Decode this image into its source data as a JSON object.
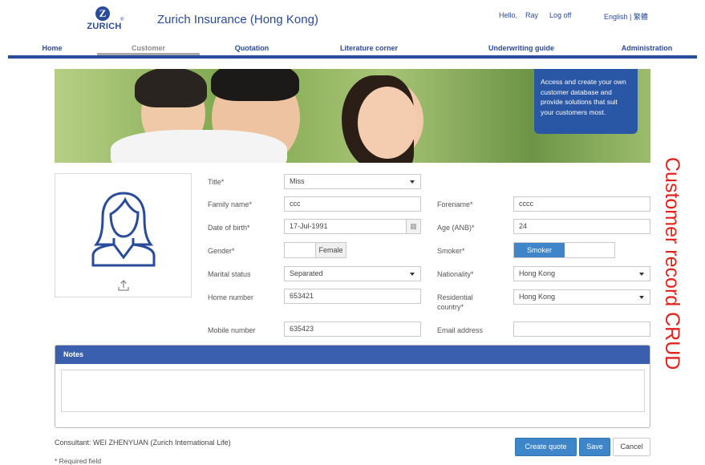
{
  "header": {
    "logo_mark": "Z",
    "logo_text": "ZURICH",
    "logo_reg": "®",
    "app_title": "Zurich Insurance (Hong Kong)",
    "greeting": "Hello,",
    "user_name": "Ray",
    "logoff": "Log off",
    "language": "English | 繁體"
  },
  "nav": {
    "items": [
      {
        "label": "Home"
      },
      {
        "label": "Customer"
      },
      {
        "label": "Quotation"
      },
      {
        "label": "Literature corner"
      },
      {
        "label": "Underwriting guide"
      },
      {
        "label": "Administration"
      }
    ],
    "active": "Customer"
  },
  "banner": {
    "callout": "Access and create your own customer database and provide solutions that suit your customers most."
  },
  "form": {
    "title": {
      "label": "Title*",
      "value": "Miss"
    },
    "family_name": {
      "label": "Family name*",
      "value": "ccc"
    },
    "forename": {
      "label": "Forename*",
      "value": "cccc"
    },
    "dob": {
      "label": "Date of birth*",
      "value": "17-Jul-1991"
    },
    "age": {
      "label": "Age (ANB)*",
      "value": "24"
    },
    "gender": {
      "label": "Gender*",
      "selected": "Female"
    },
    "smoker": {
      "label": "Smoker*",
      "selected": "Smoker"
    },
    "marital": {
      "label": "Marital status",
      "value": "Separated"
    },
    "nationality": {
      "label": "Nationality*",
      "value": "Hong Kong"
    },
    "home_number": {
      "label": "Home number",
      "value": "653421"
    },
    "residential": {
      "label": "Residential country*",
      "value": "Hong Kong"
    },
    "mobile": {
      "label": "Mobile number",
      "value": "635423"
    },
    "email": {
      "label": "Email address",
      "value": ""
    }
  },
  "notes": {
    "header": "Notes",
    "value": ""
  },
  "footer": {
    "consultant": "Consultant: WEI ZHENYUAN (Zurich International Life)",
    "required": "* Required field"
  },
  "buttons": {
    "create_quote": "Create quote",
    "save": "Save",
    "cancel": "Cancel"
  },
  "side_title": "Customer record CRUD",
  "colors": {
    "brand_blue": "#2a4b9b",
    "primary_button": "#3e86c9",
    "notes_header": "#3a5fae",
    "side_title": "#e3231b"
  }
}
